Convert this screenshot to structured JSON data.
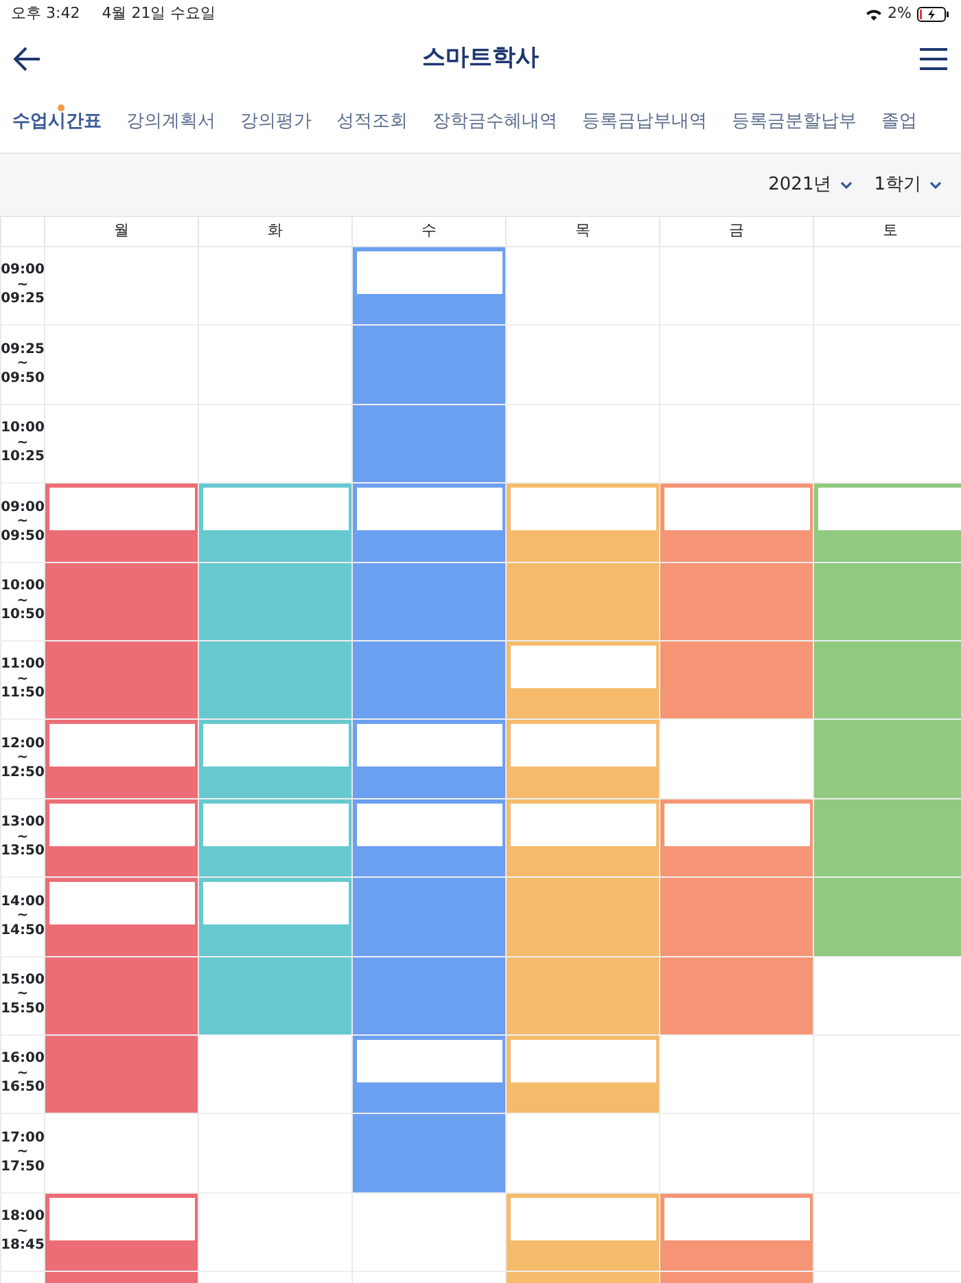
{
  "status_bar": {
    "time": "오후 3:42",
    "date": "4월 21일 수요일",
    "battery": "2%"
  },
  "header": {
    "title": "스마트학사"
  },
  "tabs": [
    {
      "label": "수업시간표",
      "selected": true,
      "dot": true
    },
    {
      "label": "강의계획서",
      "selected": false,
      "dot": false
    },
    {
      "label": "강의평가",
      "selected": false,
      "dot": false
    },
    {
      "label": "성적조회",
      "selected": false,
      "dot": false
    },
    {
      "label": "장학금수혜내역",
      "selected": false,
      "dot": false
    },
    {
      "label": "등록금납부내역",
      "selected": false,
      "dot": false
    },
    {
      "label": "등록금분할납부",
      "selected": false,
      "dot": false
    },
    {
      "label": "졸업",
      "selected": false,
      "dot": false
    }
  ],
  "filters": [
    {
      "label": "2021년"
    },
    {
      "label": "1학기"
    }
  ],
  "timetable": {
    "days": [
      "월",
      "화",
      "수",
      "목",
      "금",
      "토"
    ],
    "rows": [
      {
        "time": "09:00\n~\n09:25",
        "cells": [
          {},
          {},
          {
            "color": "#6b9ff0",
            "blank": true
          },
          {},
          {},
          {}
        ]
      },
      {
        "time": "09:25\n~\n09:50",
        "cells": [
          {},
          {},
          {
            "color": "#6b9ff0"
          },
          {},
          {},
          {}
        ]
      },
      {
        "time": "10:00\n~\n10:25",
        "cells": [
          {},
          {},
          {
            "color": "#6b9ff0"
          },
          {},
          {},
          {}
        ]
      },
      {
        "time": "09:00\n~\n09:50",
        "cells": [
          {
            "color": "#ec6d76",
            "blank": true
          },
          {
            "color": "#67c8cf",
            "blank": true
          },
          {
            "color": "#6b9ff0",
            "blank": true
          },
          {
            "color": "#f5bb6b",
            "blank": true
          },
          {
            "color": "#f59575",
            "blank": true
          },
          {
            "color": "#8fca7f",
            "blank": true
          }
        ]
      },
      {
        "time": "10:00\n~\n10:50",
        "cells": [
          {
            "color": "#ec6d76"
          },
          {
            "color": "#67c8cf"
          },
          {
            "color": "#6b9ff0"
          },
          {
            "color": "#f5bb6b"
          },
          {
            "color": "#f59575"
          },
          {
            "color": "#8fca7f"
          }
        ]
      },
      {
        "time": "11:00\n~\n11:50",
        "cells": [
          {
            "color": "#ec6d76"
          },
          {
            "color": "#67c8cf"
          },
          {
            "color": "#6b9ff0"
          },
          {
            "color": "#f5bb6b",
            "blank": true
          },
          {
            "color": "#f59575"
          },
          {
            "color": "#8fca7f"
          }
        ]
      },
      {
        "time": "12:00\n~\n12:50",
        "cells": [
          {
            "color": "#ec6d76",
            "blank": true
          },
          {
            "color": "#67c8cf",
            "blank": true
          },
          {
            "color": "#6b9ff0",
            "blank": true
          },
          {
            "color": "#f5bb6b",
            "blank": true
          },
          {},
          {
            "color": "#8fca7f"
          }
        ]
      },
      {
        "time": "13:00\n~\n13:50",
        "cells": [
          {
            "color": "#ec6d76",
            "blank": true
          },
          {
            "color": "#67c8cf",
            "blank": true
          },
          {
            "color": "#6b9ff0",
            "blank": true
          },
          {
            "color": "#f5bb6b",
            "blank": true
          },
          {
            "color": "#f59575",
            "blank": true
          },
          {
            "color": "#8fca7f"
          }
        ]
      },
      {
        "time": "14:00\n~\n14:50",
        "cells": [
          {
            "color": "#ec6d76",
            "blank": true
          },
          {
            "color": "#67c8cf",
            "blank": true
          },
          {
            "color": "#6b9ff0"
          },
          {
            "color": "#f5bb6b"
          },
          {
            "color": "#f59575"
          },
          {
            "color": "#8fca7f"
          }
        ]
      },
      {
        "time": "15:00\n~\n15:50",
        "cells": [
          {
            "color": "#ec6d76"
          },
          {
            "color": "#67c8cf"
          },
          {
            "color": "#6b9ff0"
          },
          {
            "color": "#f5bb6b"
          },
          {
            "color": "#f59575"
          },
          {}
        ]
      },
      {
        "time": "16:00\n~\n16:50",
        "cells": [
          {
            "color": "#ec6d76"
          },
          {},
          {
            "color": "#6b9ff0",
            "blank": true
          },
          {
            "color": "#f5bb6b",
            "blank": true
          },
          {},
          {}
        ]
      },
      {
        "time": "17:00\n~\n17:50",
        "cells": [
          {},
          {},
          {
            "color": "#6b9ff0"
          },
          {},
          {},
          {}
        ]
      },
      {
        "time": "18:00\n~\n18:45",
        "cells": [
          {
            "color": "#ec6d76",
            "blank": true
          },
          {},
          {},
          {
            "color": "#f5bb6b",
            "blank": true
          },
          {
            "color": "#f59575",
            "blank": true
          },
          {}
        ]
      },
      {
        "cells": [
          {
            "color": "#ec6d76"
          },
          {},
          {},
          {
            "color": "#f5bb6b"
          },
          {
            "color": "#f59575"
          },
          {}
        ]
      }
    ]
  }
}
